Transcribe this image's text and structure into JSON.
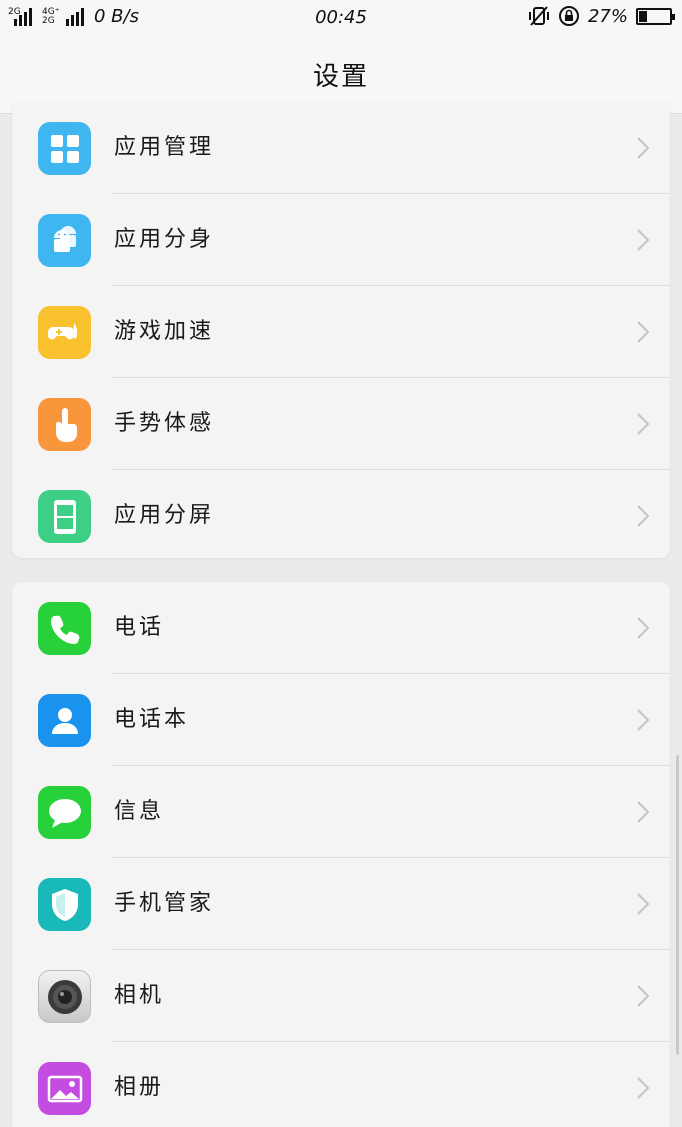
{
  "status_bar": {
    "sig1_tag": "2G",
    "sig2_tag": "4G⁺",
    "sig2_tag_b": "2G",
    "net_speed": "0 B/s",
    "time": "00:45",
    "battery_percent": "27%",
    "battery_level": 0.27
  },
  "header": {
    "title": "设置"
  },
  "group1": [
    {
      "label": "应用管理",
      "icon": "app-manager-icon",
      "color": "#3fb6f0"
    },
    {
      "label": "应用分身",
      "icon": "app-clone-icon",
      "color": "#3fb6f0"
    },
    {
      "label": "游戏加速",
      "icon": "game-boost-icon",
      "color": "#f9c12e"
    },
    {
      "label": "手势体感",
      "icon": "gesture-icon",
      "color": "#f9953a"
    },
    {
      "label": "应用分屏",
      "icon": "split-screen-icon",
      "color": "#3ecf86"
    }
  ],
  "group2": [
    {
      "label": "电话",
      "icon": "phone-icon",
      "color": "#27d13a"
    },
    {
      "label": "电话本",
      "icon": "contacts-icon",
      "color": "#1a93ef"
    },
    {
      "label": "信息",
      "icon": "messages-icon",
      "color": "#27d13a"
    },
    {
      "label": "手机管家",
      "icon": "phone-manager-icon",
      "color": "#18b9b8"
    },
    {
      "label": "相机",
      "icon": "camera-icon",
      "color": "#d0d0d0"
    },
    {
      "label": "相册",
      "icon": "gallery-icon",
      "color": "#c44ce0"
    }
  ]
}
